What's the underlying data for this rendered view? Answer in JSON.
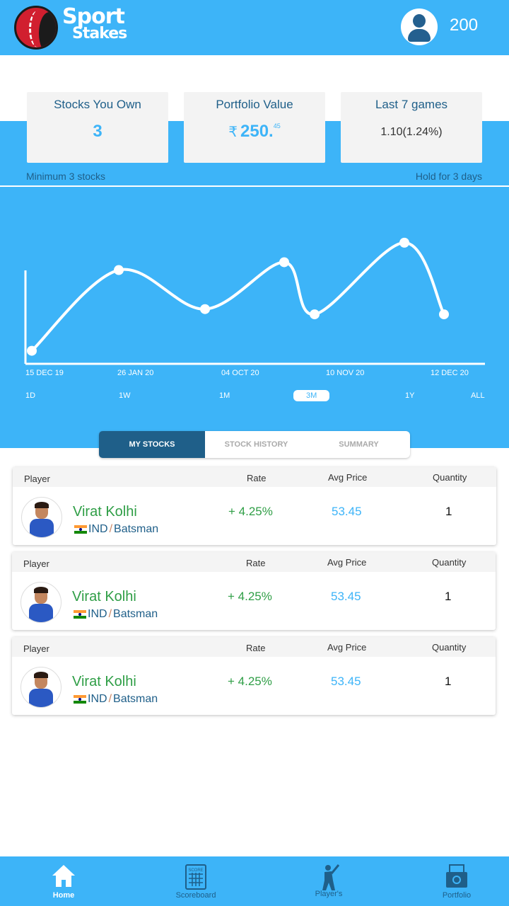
{
  "app": {
    "logo_line1": "Sport",
    "logo_line2": "Stakes",
    "coins": "200"
  },
  "summary": {
    "cards": [
      {
        "title": "Stocks You Own",
        "value": "3"
      },
      {
        "title": "Portfolio Value",
        "currency": "₹",
        "value": "250.",
        "decimal": "45"
      },
      {
        "title": "Last 7 games",
        "value": "1.10(1.24%)"
      }
    ],
    "note_left": "Minimum 3 stocks",
    "note_right": "Hold for 3 days"
  },
  "chart_data": {
    "type": "line",
    "x": [
      "15 DEC 19",
      "26 JAN 20",
      "",
      "04 OCT 20",
      "",
      "10 NOV 20",
      "",
      "12 DEC 20"
    ],
    "values": [
      0.1,
      0.72,
      0.42,
      0.78,
      0.38,
      0.93,
      0.38
    ],
    "tick_labels": [
      "15 DEC 19",
      "26 JAN 20",
      "04 OCT 20",
      "10 NOV 20",
      "12 DEC 20"
    ],
    "ranges": [
      "1D",
      "1W",
      "1M",
      "3M",
      "1Y",
      "ALL"
    ],
    "selected_range": "3M",
    "grid": false,
    "line_color": "#ffffff"
  },
  "tabs": {
    "items": [
      "MY STOCKS",
      "STOCK HISTORY",
      "SUMMARY"
    ],
    "active": "MY STOCKS"
  },
  "stocks": {
    "headers": {
      "player": "Player",
      "rate": "Rate",
      "avg": "Avg Price",
      "qty": "Quantity"
    },
    "rows": [
      {
        "name": "Virat Kolhi",
        "country": "IND",
        "role": "Batsman",
        "rate": "+ 4.25%",
        "avg": "53.45",
        "qty": "1"
      },
      {
        "name": "Virat Kolhi",
        "country": "IND",
        "role": "Batsman",
        "rate": "+ 4.25%",
        "avg": "53.45",
        "qty": "1"
      },
      {
        "name": "Virat Kolhi",
        "country": "IND",
        "role": "Batsman",
        "rate": "+ 4.25%",
        "avg": "53.45",
        "qty": "1"
      }
    ]
  },
  "nav": {
    "items": [
      {
        "label": "Home",
        "icon": "home-icon"
      },
      {
        "label": "Scoreboard",
        "icon": "scoreboard-icon"
      },
      {
        "label": "Player's",
        "icon": "batsman-icon"
      },
      {
        "label": "Portfolio",
        "icon": "portfolio-icon"
      }
    ],
    "active": "Home",
    "score_text": "SCORE"
  },
  "colors": {
    "primary": "#3db4f8",
    "dark": "#1f5f89",
    "positive": "#2f9e46"
  }
}
